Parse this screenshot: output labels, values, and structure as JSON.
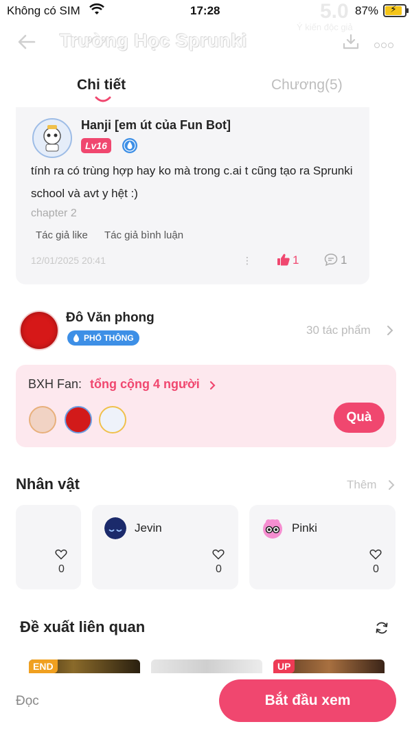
{
  "status_bar": {
    "carrier": "Không có SIM",
    "time": "17:28",
    "battery": "87%"
  },
  "background_header": {
    "rating": "5.0",
    "rating_subtitle": "Ý kiến độc giả"
  },
  "nav": {
    "title": "Trường Học Sprunki",
    "icons": [
      "back-arrow-icon",
      "download-icon",
      "more-icon"
    ]
  },
  "tabs": [
    {
      "label": "Chi tiết",
      "active": true
    },
    {
      "label": "Chương(5)",
      "active": false
    }
  ],
  "comment": {
    "username": "Hanji [em út của Fun Bot]",
    "level": "Lv16",
    "text": "tính ra có trùng hợp hay ko mà trong c.ai t cũng tạo ra Sprunki school và avt y hệt :)",
    "chapter": "chapter 2",
    "tags": [
      "Tác giả like",
      "Tác giả bình luận"
    ],
    "date": "12/01/2025 20:41",
    "likes": "1",
    "replies": "1"
  },
  "author": {
    "name": "Đô Văn phong",
    "badge": "PHỔ THÔNG",
    "works": "30 tác phẩm"
  },
  "fan_ranking": {
    "label": "BXH Fan:",
    "total": "tổng cộng 4 người",
    "gift_button": "Quà"
  },
  "characters": {
    "title": "Nhân vật",
    "more": "Thêm",
    "items": [
      {
        "name": "",
        "likes": "0"
      },
      {
        "name": "Jevin",
        "likes": "0"
      },
      {
        "name": "Pinki",
        "likes": "0"
      }
    ]
  },
  "related": {
    "title": "Đề xuất liên quan",
    "thumb_tags": [
      "END",
      "",
      "UP"
    ]
  },
  "bottom": {
    "read_label": "Đọc",
    "start_button": "Bắt đầu xem"
  },
  "colors": {
    "accent": "#f0476f",
    "fan_background": "#fde8ee",
    "badge_blue": "#3d8fe6"
  }
}
